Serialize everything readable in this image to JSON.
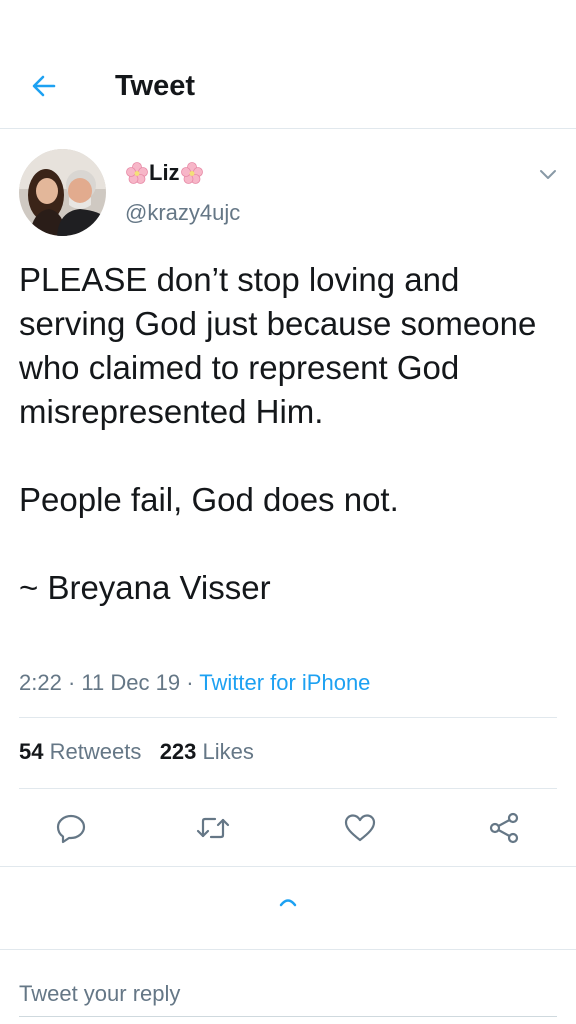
{
  "header": {
    "title": "Tweet",
    "back_icon": "arrow-left-icon"
  },
  "author": {
    "name": "Liz",
    "name_decoration": "cherry-blossom-emoji",
    "handle": "@krazy4ujc"
  },
  "tweet": {
    "text": "PLEASE don’t stop loving and serving God just because someone who claimed to represent God misrepresented Him.\n\nPeople fail, God does not.\n\n~ Breyana Visser",
    "time": "2:22",
    "date": "11 Dec 19",
    "separator": "·",
    "source": "Twitter for iPhone"
  },
  "stats": {
    "retweets_count": "54",
    "retweets_label": "Retweets",
    "likes_count": "223",
    "likes_label": "Likes"
  },
  "actions": [
    "reply-icon",
    "retweet-icon",
    "like-icon",
    "share-icon"
  ],
  "reply": {
    "placeholder": "Tweet your reply"
  },
  "colors": {
    "accent": "#1da1f2",
    "text_primary": "#14171a",
    "text_secondary": "#657786",
    "divider": "#e1e8ed"
  }
}
